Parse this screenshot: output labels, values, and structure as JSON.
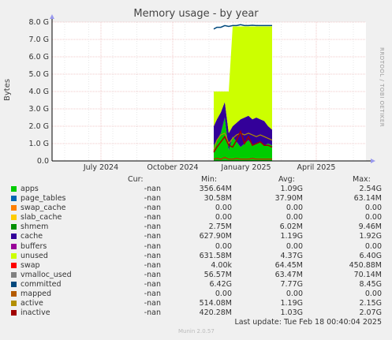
{
  "title": "Memory usage - by year",
  "side_label": "RRDTOOL / TOBI OETIKER",
  "chart_data": {
    "type": "area",
    "ylabel": "Bytes",
    "yticks": [
      "0.0",
      "1.0 G",
      "2.0 G",
      "3.0 G",
      "4.0 G",
      "5.0 G",
      "6.0 G",
      "7.0 G",
      "8.0 G"
    ],
    "ylim": [
      0,
      8.0
    ],
    "xticks": [
      "July 2024",
      "October 2024",
      "January 2025",
      "April 2025"
    ],
    "grid": true,
    "series": [
      {
        "name": "apps",
        "color": "#00cc00"
      },
      {
        "name": "page_tables",
        "color": "#0066b3"
      },
      {
        "name": "swap_cache",
        "color": "#ff8000"
      },
      {
        "name": "slab_cache",
        "color": "#ffcc00"
      },
      {
        "name": "shmem",
        "color": "#330099"
      },
      {
        "name": "cache",
        "color": "#990099"
      },
      {
        "name": "buffers",
        "color": "#ccff00"
      },
      {
        "name": "unused",
        "color": "#ff0000"
      },
      {
        "name": "swap",
        "color": "#808080"
      },
      {
        "name": "vmalloc_used",
        "color": "#008f00"
      },
      {
        "name": "committed",
        "color": "#00487d"
      },
      {
        "name": "mapped",
        "color": "#b35a00"
      },
      {
        "name": "active",
        "color": "#b38f00"
      },
      {
        "name": "inactive",
        "color": "#6b006b"
      }
    ]
  },
  "legend": {
    "headers": {
      "cur": "Cur:",
      "min": "Min:",
      "avg": "Avg:",
      "max": "Max:"
    },
    "rows": [
      {
        "name": "apps",
        "color": "#00cc00",
        "cur": "-nan",
        "min": "356.64M",
        "avg": "1.09G",
        "max": "2.54G"
      },
      {
        "name": "page_tables",
        "color": "#0066b3",
        "cur": "-nan",
        "min": "30.58M",
        "avg": "37.90M",
        "max": "63.14M"
      },
      {
        "name": "swap_cache",
        "color": "#ff8000",
        "cur": "-nan",
        "min": "0.00",
        "avg": "0.00",
        "max": "0.00"
      },
      {
        "name": "slab_cache",
        "color": "#ffcc00",
        "cur": "-nan",
        "min": "0.00",
        "avg": "0.00",
        "max": "0.00"
      },
      {
        "name": "shmem",
        "color": "#008f00",
        "cur": "-nan",
        "min": "2.75M",
        "avg": "6.02M",
        "max": "9.46M"
      },
      {
        "name": "cache",
        "color": "#330099",
        "cur": "-nan",
        "min": "627.90M",
        "avg": "1.19G",
        "max": "1.92G"
      },
      {
        "name": "buffers",
        "color": "#990099",
        "cur": "-nan",
        "min": "0.00",
        "avg": "0.00",
        "max": "0.00"
      },
      {
        "name": "unused",
        "color": "#ccff00",
        "cur": "-nan",
        "min": "631.58M",
        "avg": "4.37G",
        "max": "6.40G"
      },
      {
        "name": "swap",
        "color": "#ff0000",
        "cur": "-nan",
        "min": "4.00k",
        "avg": "64.45M",
        "max": "450.88M"
      },
      {
        "name": "vmalloc_used",
        "color": "#808080",
        "cur": "-nan",
        "min": "56.57M",
        "avg": "63.47M",
        "max": "70.14M"
      },
      {
        "name": "committed",
        "color": "#00487d",
        "cur": "-nan",
        "min": "6.42G",
        "avg": "7.77G",
        "max": "8.45G"
      },
      {
        "name": "mapped",
        "color": "#b35a00",
        "cur": "-nan",
        "min": "0.00",
        "avg": "0.00",
        "max": "0.00"
      },
      {
        "name": "active",
        "color": "#b38f00",
        "cur": "-nan",
        "min": "514.08M",
        "avg": "1.19G",
        "max": "2.15G"
      },
      {
        "name": "inactive",
        "color": "#a00000",
        "cur": "-nan",
        "min": "420.28M",
        "avg": "1.03G",
        "max": "2.07G"
      }
    ]
  },
  "last_update": "Last update: Tue Feb 18 00:40:04 2025",
  "version": "Munin 2.0.57"
}
